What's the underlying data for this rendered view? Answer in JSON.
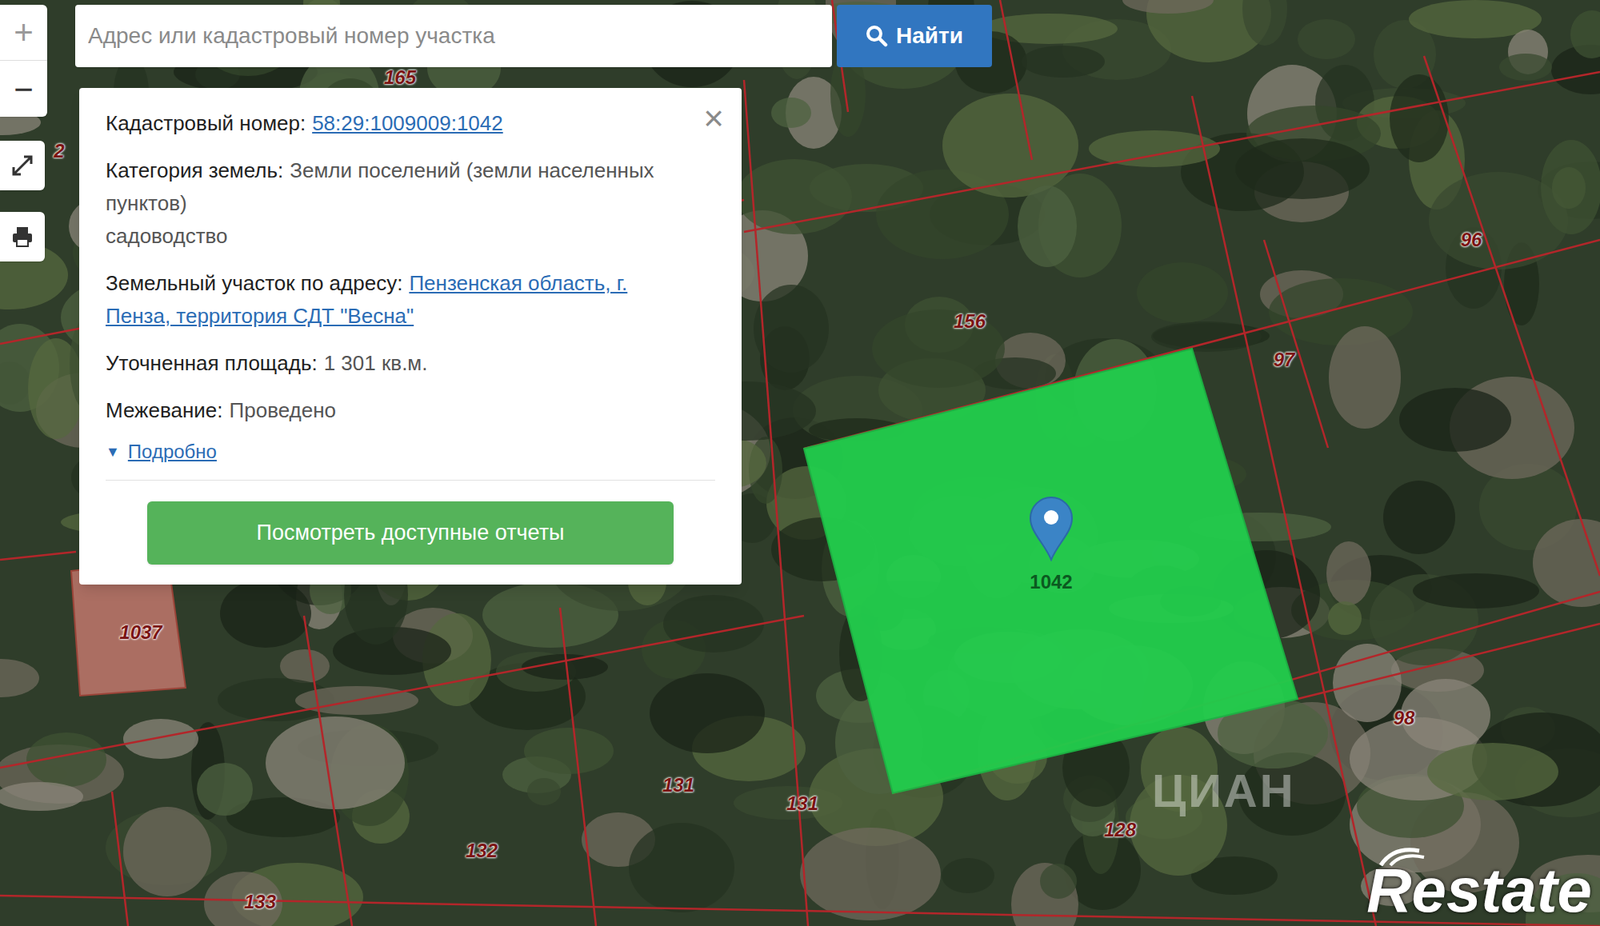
{
  "map_controls": {
    "zoom_in": "+",
    "zoom_out": "−"
  },
  "search": {
    "placeholder": "Адрес или кадастровый номер участка",
    "button": "Найти"
  },
  "popup": {
    "close": "×",
    "fields": [
      {
        "label": "Кадастровый номер:",
        "value": "58:29:1009009:1042",
        "kind": "link"
      },
      {
        "label": "Категория земель:",
        "value": "Земли поселений (земли населенных пунктов)",
        "kind": "text",
        "note": "садоводство"
      },
      {
        "label": "Земельный участок по адресу:",
        "value": "Пензенская область, г. Пенза, территория СДТ \"Весна\"",
        "kind": "link"
      },
      {
        "label": "Уточненная площадь:",
        "value": "1 301 кв.м.",
        "kind": "text"
      },
      {
        "label": "Межевание:",
        "value": "Проведено",
        "kind": "text"
      }
    ],
    "details": {
      "icon": "▼",
      "label": "Подробно"
    },
    "reports_button": "Посмотреть доступные отчеты"
  },
  "parcels": [
    {
      "label": "165",
      "selected": false,
      "highlighted": false
    },
    {
      "label": "2",
      "selected": false,
      "highlighted": false
    },
    {
      "label": "156",
      "selected": false,
      "highlighted": false
    },
    {
      "label": "96",
      "selected": false,
      "highlighted": false
    },
    {
      "label": "97",
      "selected": false,
      "highlighted": false
    },
    {
      "label": "98",
      "selected": false,
      "highlighted": false
    },
    {
      "label": "1037",
      "selected": false,
      "highlighted": true
    },
    {
      "label": "131",
      "selected": false,
      "highlighted": false
    },
    {
      "label": "131",
      "selected": false,
      "highlighted": false
    },
    {
      "label": "132",
      "selected": false,
      "highlighted": false
    },
    {
      "label": "133",
      "selected": false,
      "highlighted": false
    },
    {
      "label": "128",
      "selected": false,
      "highlighted": false
    },
    {
      "label": "1042",
      "selected": true,
      "highlighted": false
    }
  ],
  "watermark": "ЦИАН",
  "logo": "Restate"
}
